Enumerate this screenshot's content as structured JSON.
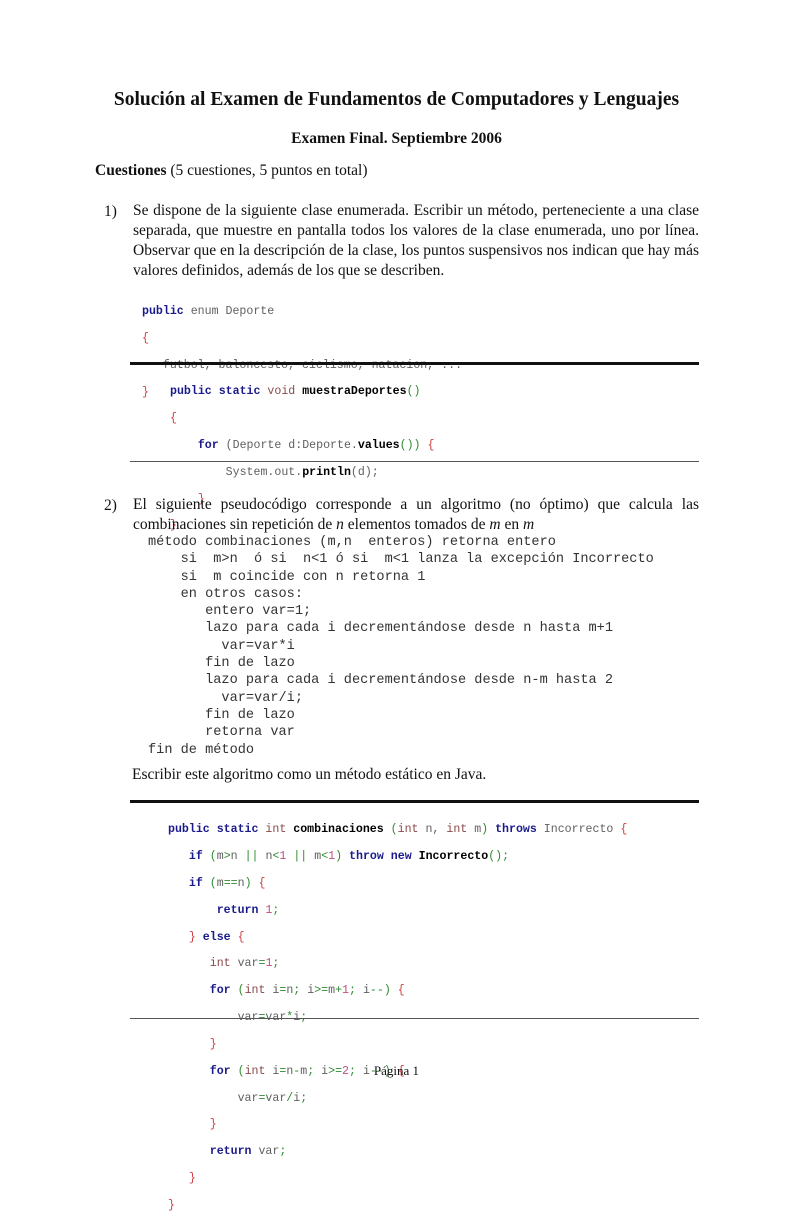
{
  "header": {
    "title": "Solución al Examen de Fundamentos de Computadores y Lenguajes",
    "subtitle": "Examen Final. Septiembre 2006"
  },
  "section": {
    "label": "Cuestiones",
    "detail": " (5 cuestiones, 5 puntos en total)"
  },
  "questions": [
    {
      "number": "1)",
      "text": "Se dispone de la siguiente clase enumerada. Escribir un método, perteneciente a una clase separada, que muestre en pantalla todos los valores de la clase enumerada, uno por línea. Observar que en la descripción de la clase, los puntos suspensivos nos indican que hay más valores definidos, además de los que se describen.",
      "given_code": {
        "l1_kw": "public",
        "l1_rest": " enum Deporte",
        "l2": "{",
        "l3": "   futbol, baloncesto, ciclismo, natacion, ...",
        "l4": "}"
      },
      "solution_code": {
        "l1_kw": "public static",
        "l1_type": " void",
        "l1_name": " muestraDeportes",
        "l1_paren": "()",
        "l2": "{",
        "l3_kw": "for",
        "l3_a": " (Deporte d:Deporte.",
        "l3_call": "values",
        "l3_b": "()) ",
        "l3_br": "{",
        "l4_a": "System.out.",
        "l4_call": "println",
        "l4_b": "(d);",
        "l5": "}",
        "l6": "}"
      }
    },
    {
      "number": "2)",
      "text_a": "El siguiente pseudocódigo corresponde a un algoritmo (no óptimo) que calcula las combinaciones sin repetición de ",
      "text_n": "n",
      "text_b": " elementos tomados de ",
      "text_m1": "m",
      "text_c": " en ",
      "text_m2": "m",
      "pseudocode": [
        "método combinaciones (m,n  enteros) retorna entero",
        "    si  m>n  ó si  n<1 ó si  m<1 lanza la excepción Incorrecto",
        "    si  m coincide con n retorna 1",
        "    en otros casos:",
        "       entero var=1;",
        "       lazo para cada i decrementándose desde n hasta m+1",
        "         var=var*i",
        "       fin de lazo",
        "       lazo para cada i decrementándose desde n-m hasta 2",
        "         var=var/i;",
        "       fin de lazo",
        "       retorna var",
        "fin de método"
      ],
      "instruction": "Escribir este algoritmo como un método estático en Java."
    }
  ],
  "footer": {
    "page": "Página 1"
  },
  "colors": {
    "keyword": "#1a1a8c",
    "type": "#8a4a4a",
    "bracket": "#d04040",
    "operator": "#2e8b2e",
    "number": "#c05080",
    "plain": "#606060"
  }
}
